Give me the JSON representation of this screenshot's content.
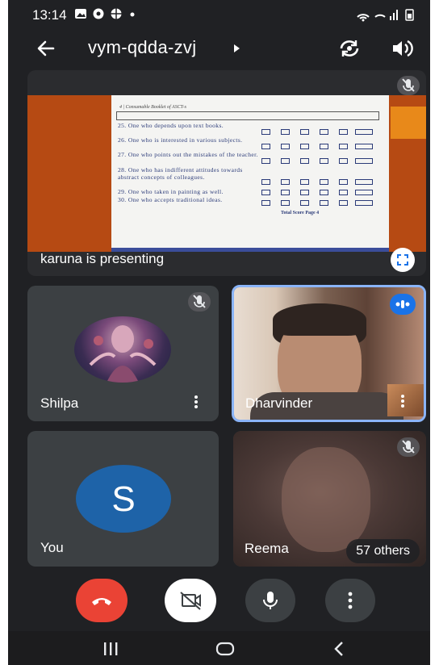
{
  "status_bar": {
    "time": "13:14"
  },
  "header": {
    "meeting_code": "vym-qdda-zvj"
  },
  "presentation": {
    "presenter_label": "karuna is presenting",
    "document": {
      "heading": "4 | Consumable Booklet of ASCT-s",
      "questions": [
        "25. One who depends upon text books.",
        "26. One who is interested in various subjects.",
        "27. One who points out the mistakes of the teacher.",
        "28. One who has indifferent attitudes towards abstract concepts of colleagues.",
        "29. One who taken in painting as well.",
        "30. One who accepts traditional ideas."
      ],
      "total_score": "Total Score Page 4"
    }
  },
  "participants": [
    {
      "name": "Shilpa"
    },
    {
      "name": "Dharvinder"
    },
    {
      "name": "You",
      "initial": "S"
    },
    {
      "name": "Reema"
    }
  ],
  "others_count_label": "57 others",
  "colors": {
    "end_call": "#ea4335",
    "active_speaker_border": "#8ab4f8",
    "speaking_badge": "#1a73e8",
    "avatar_you": "#1e63a8"
  },
  "icons": {
    "back": "arrow-left-icon",
    "switch_camera": "camera-switch-icon",
    "audio": "speaker-icon",
    "fullscreen": "fullscreen-icon",
    "muted": "mic-off-icon",
    "end_call": "phone-hangup-icon",
    "camera": "camera-off-icon",
    "mic": "mic-icon",
    "more": "more-vertical-icon"
  }
}
